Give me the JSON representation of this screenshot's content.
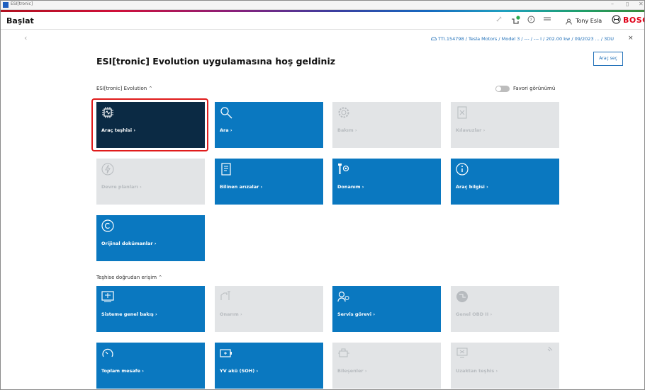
{
  "window": {
    "title": "ESI[tronic]",
    "min": "–",
    "restore": "▯",
    "close": "✕"
  },
  "header": {
    "title": "Başlat",
    "user": "Tony Esla",
    "brand": "BOSCH"
  },
  "breadcrumb": {
    "text": "TTI.154798 / Tesla Motors / Model 3 / --- / --- I / 202.00 kw / 09/2023 ... / 3DU",
    "close": "×"
  },
  "welcome": "ESI[tronic] Evolution uygulamasına hoş geldiniz",
  "select_vehicle": "Araç seç",
  "section1": {
    "label": "ESI[tronic] Evolution  ⌃"
  },
  "favorite_view": "Favori görünümü",
  "section2": {
    "label": "Teşhise doğrudan erişim  ⌃"
  },
  "tiles": {
    "diagnosis": "Araç teşhisi  ›",
    "search": "Ara  ›",
    "maintenance": "Bakım  ›",
    "guides": "Kılavuzlar  ›",
    "circuits": "Devre planları  ›",
    "known_faults": "Bilinen arızalar  ›",
    "equipment": "Donanım  ›",
    "vehicle_info": "Araç bilgisi  ›",
    "original_docs": "Orijinal dokümanlar  ›",
    "system_overview": "Sisteme genel bakış  ›",
    "repair": "Onarım  ›",
    "service_task": "Servis görevi  ›",
    "obd": "Genel OBD II  ›",
    "mileage": "Toplam mesafe  ›",
    "battery": "YV akü (SOH)  ›",
    "components": "Bileşenler  ›",
    "remote": "Uzaktan teşhis  ›"
  },
  "colors": {
    "blue": "#0a78c0",
    "dark": "#0b2a44",
    "grey": "#e2e4e6",
    "highlight": "#e01b1b",
    "brand_red": "#e00018"
  }
}
